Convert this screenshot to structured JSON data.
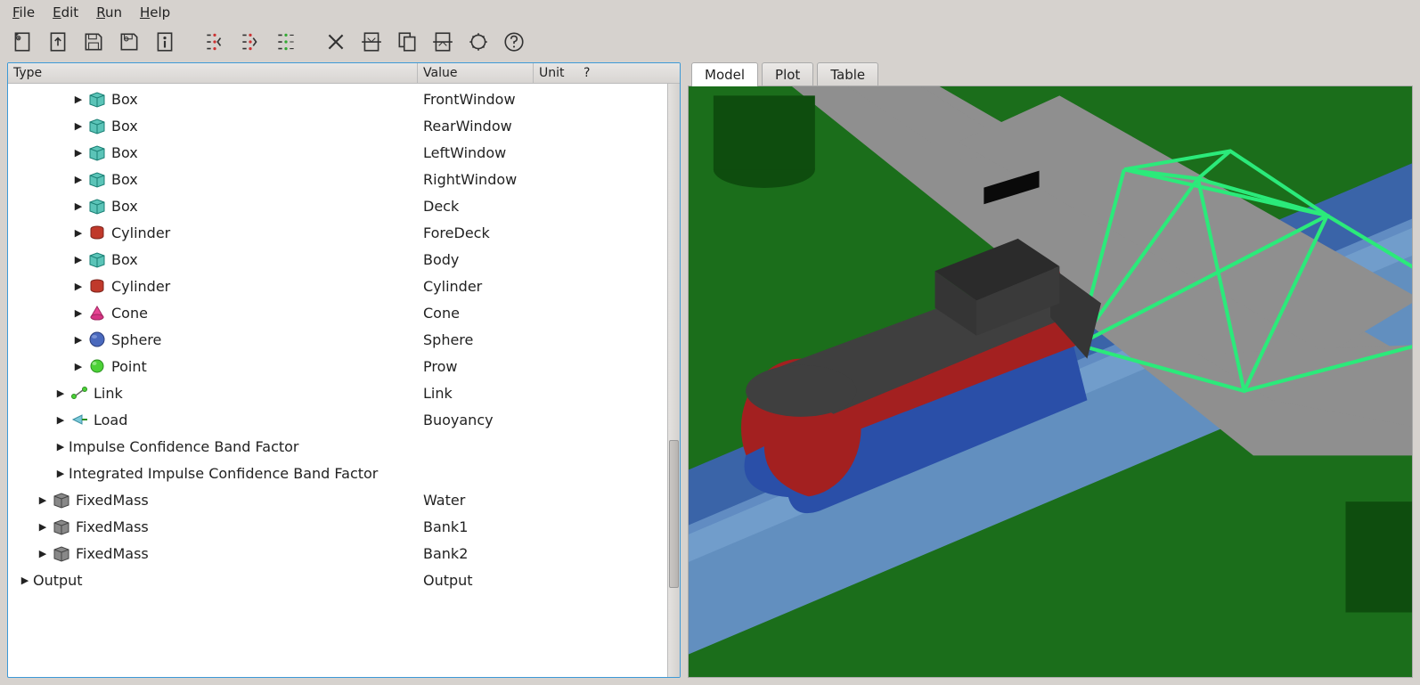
{
  "menu": {
    "file": "File",
    "edit": "Edit",
    "run": "Run",
    "help": "Help"
  },
  "tree_header": {
    "type": "Type",
    "value": "Value",
    "unit": "Unit",
    "q": "?"
  },
  "tabs": {
    "model": "Model",
    "plot": "Plot",
    "table": "Table"
  },
  "rows": [
    {
      "indent": 3,
      "icon": "box",
      "type": "Box",
      "value": "FrontWindow"
    },
    {
      "indent": 3,
      "icon": "box",
      "type": "Box",
      "value": "RearWindow"
    },
    {
      "indent": 3,
      "icon": "box",
      "type": "Box",
      "value": "LeftWindow"
    },
    {
      "indent": 3,
      "icon": "box",
      "type": "Box",
      "value": "RightWindow"
    },
    {
      "indent": 3,
      "icon": "box",
      "type": "Box",
      "value": "Deck"
    },
    {
      "indent": 3,
      "icon": "cylinder",
      "type": "Cylinder",
      "value": "ForeDeck"
    },
    {
      "indent": 3,
      "icon": "box",
      "type": "Box",
      "value": "Body"
    },
    {
      "indent": 3,
      "icon": "cylinder",
      "type": "Cylinder",
      "value": "Cylinder"
    },
    {
      "indent": 3,
      "icon": "cone",
      "type": "Cone",
      "value": "Cone"
    },
    {
      "indent": 3,
      "icon": "sphere",
      "type": "Sphere",
      "value": "Sphere"
    },
    {
      "indent": 3,
      "icon": "point",
      "type": "Point",
      "value": "Prow"
    },
    {
      "indent": 2,
      "icon": "link",
      "type": "Link",
      "value": "Link"
    },
    {
      "indent": 2,
      "icon": "load",
      "type": "Load",
      "value": "Buoyancy"
    },
    {
      "indent": 2,
      "icon": "none",
      "type": "Impulse Confidence Band Factor",
      "value": ""
    },
    {
      "indent": 2,
      "icon": "none",
      "type": "Integrated Impulse Confidence Band Factor",
      "value": ""
    },
    {
      "indent": 1,
      "icon": "graybox",
      "type": "FixedMass",
      "value": "Water"
    },
    {
      "indent": 1,
      "icon": "graybox",
      "type": "FixedMass",
      "value": "Bank1"
    },
    {
      "indent": 1,
      "icon": "graybox",
      "type": "FixedMass",
      "value": "Bank2"
    },
    {
      "indent": 0,
      "icon": "none",
      "type": "Output",
      "value": "Output"
    }
  ]
}
